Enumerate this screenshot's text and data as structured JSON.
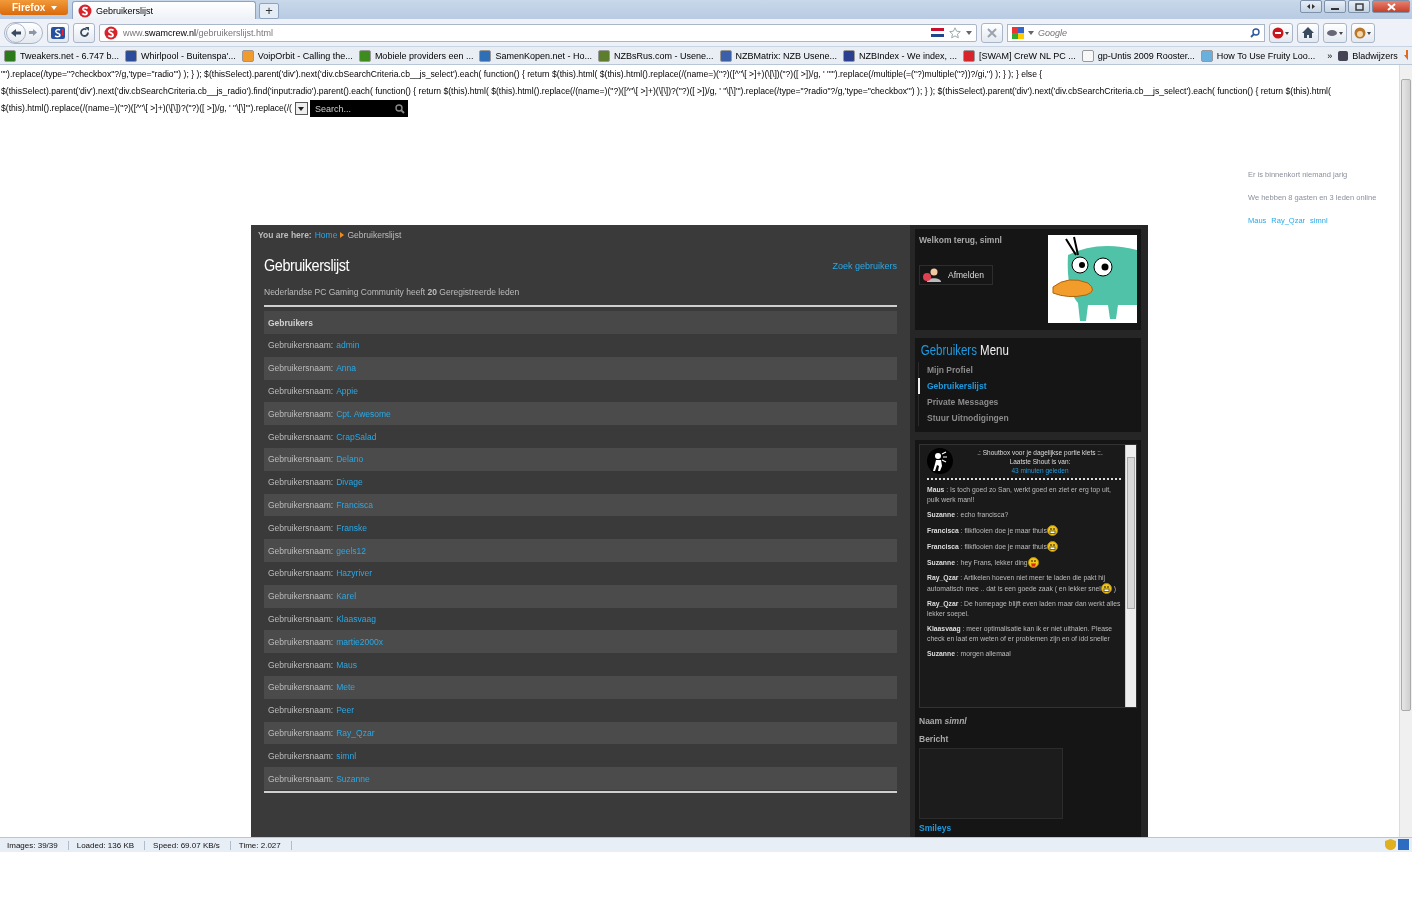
{
  "browser": {
    "app_button": "Firefox",
    "tabs": [
      {
        "title": "Gebruikerslijst",
        "selected": true
      }
    ],
    "new_tab": "+",
    "address": {
      "prefix": "www.",
      "domain": "swamcrew.nl",
      "path": "/gebruikerslijst.html"
    },
    "search": {
      "placeholder": "Google"
    },
    "bookmarks": [
      "Tweakers.net - 6.747 b...",
      "Whirlpool - Buitenspa'...",
      "VoipOrbit - Calling the...",
      "Mobiele providers een ...",
      "SamenKopen.net - Ho...",
      "NZBsRus.com - Usene...",
      "NZBMatrix: NZB Usene...",
      "NZBIndex - We index, ...",
      "[SWAM] CreW NL PC ...",
      "gp-Untis 2009 Rooster...",
      "How To Use Fruity Loo..."
    ],
    "bookmarks_overflow": "»",
    "bookmarks_menu": "Bladwijzers"
  },
  "page": {
    "code_lines": [
      "\"\").replace(/type=\"?checkbox\"?/g,'type=\"radio\"') ); } ); $(thisSelect).parent('div').next('div.cbSearchCriteria.cb__js_select').each( function() { return $(this).html( $(this).html().replace(/(name=)(\"?)([^\"\\[ >]+)(\\[\\])(\"?)([ >])/g, ' \"\"').replace(/multiple(=(\"?)multiple(\"?))?/gi,'') ); } ); } else {",
      "$(thisSelect).parent('div').next('div.cbSearchCriteria.cb__js_radio').find('input:radio').parent().each( function() { return $(this).html( $(this).html().replace(/(name=)(\"?)([^\"\\[ >]+)(\\[\\])?(\"?)([ >])/g, ' \"\\[\\]\"').replace(/type=\"?radio\"?/g,'type=\"checkbox\"') ); } ); $(thisSelect).parent('div').next('div.cbSearchCriteria.cb__js_select').each( function() { return $(this).html(",
      "$(this).html().replace(/(name=)(\"?)([^\"\\[ >]+)(\\[\\])?(\"?)([ >])/g, ' \"\\[\\]\"').replace(/("
    ],
    "search": {
      "placeholder": "Search..."
    },
    "breadcrumb": {
      "label": "You are here:",
      "items": [
        "Home",
        "Gebruikerslijst"
      ]
    },
    "title": "Gebruikerslijst",
    "search_users": "Zoek gebruikers",
    "summary": "Nederlandse PC Gaming Community heeft **20** Geregistreerde leden",
    "table": {
      "header": "Gebruikers",
      "rows": [
        {
          "label": "Gebruikersnaam:",
          "user": "admin"
        },
        {
          "label": "Gebruikersnaam:",
          "user": "Anna"
        },
        {
          "label": "Gebruikersnaam:",
          "user": "Appie"
        },
        {
          "label": "Gebruikersnaam:",
          "user": "Cpt. Awesome"
        },
        {
          "label": "Gebruikersnaam:",
          "user": "CrapSalad"
        },
        {
          "label": "Gebruikersnaam:",
          "user": "Delano"
        },
        {
          "label": "Gebruikersnaam:",
          "user": "Divage"
        },
        {
          "label": "Gebruikersnaam:",
          "user": "Francisca"
        },
        {
          "label": "Gebruikersnaam:",
          "user": "Franske"
        },
        {
          "label": "Gebruikersnaam:",
          "user": "geels12"
        },
        {
          "label": "Gebruikersnaam:",
          "user": "Hazyriver"
        },
        {
          "label": "Gebruikersnaam:",
          "user": "Karel"
        },
        {
          "label": "Gebruikersnaam:",
          "user": "Klaasvaag"
        },
        {
          "label": "Gebruikersnaam:",
          "user": "martie2000x"
        },
        {
          "label": "Gebruikersnaam:",
          "user": "Maus"
        },
        {
          "label": "Gebruikersnaam:",
          "user": "Mete"
        },
        {
          "label": "Gebruikersnaam:",
          "user": "Peer"
        },
        {
          "label": "Gebruikersnaam:",
          "user": "Ray_Qzar"
        },
        {
          "label": "Gebruikersnaam:",
          "user": "simnl"
        },
        {
          "label": "Gebruikersnaam:",
          "user": "Suzanne"
        }
      ]
    }
  },
  "sidebar": {
    "welcome": "Welkom terug, simnl",
    "logout": "Afmelden",
    "menu": {
      "title_accent": "Gebruikers",
      "title_rest": "Menu",
      "items": [
        {
          "label": "Mijn Profiel",
          "selected": false
        },
        {
          "label": "Gebruikerslijst",
          "selected": true
        },
        {
          "label": "Private Messages",
          "selected": false
        },
        {
          "label": "Stuur Uitnodigingen",
          "selected": false
        }
      ]
    },
    "shoutbox": {
      "intro": ".: Shoutbox voor je dagelijkse portie klets ::.",
      "last_label": "Laatste Shout is van:",
      "last_time": "43 minuten geleden",
      "shouts": [
        {
          "author": "Maus",
          "parts": [
            {
              "kind": "text",
              "text": " : Is toch goed zo San, werkt goed en ziet er erg top uit, puik werk man!!"
            }
          ]
        },
        {
          "author": "Suzanne",
          "parts": [
            {
              "kind": "text",
              "text": " : echo francisca?"
            }
          ]
        },
        {
          "author": "Francisca",
          "parts": [
            {
              "kind": "text",
              "text": " : flikflooien doe je maar thuis"
            },
            {
              "kind": "smiley"
            }
          ]
        },
        {
          "author": "Francisca",
          "parts": [
            {
              "kind": "text",
              "text": " : flikflooien doe je maar thuis"
            },
            {
              "kind": "smiley"
            }
          ]
        },
        {
          "author": "Suzanne",
          "parts": [
            {
              "kind": "text",
              "text": " : hey Frans, lekker ding"
            },
            {
              "kind": "tongue"
            }
          ]
        },
        {
          "author": "Ray_Qzar",
          "parts": [
            {
              "kind": "text",
              "text": " : Artikelen hoeven niet meer te laden die pakt hij automatisch mee .. dat is een goede zaak ( en lekker snel"
            },
            {
              "kind": "smiley"
            },
            {
              "kind": "text",
              "text": " )"
            }
          ]
        },
        {
          "author": "Ray_Qzar",
          "parts": [
            {
              "kind": "text",
              "text": " : De homepage blijft even laden maar dan werkt alles lekker soepel."
            }
          ]
        },
        {
          "author": "Klaasvaag",
          "parts": [
            {
              "kind": "text",
              "text": " : meer optimalisatie kan ik er niet uithalen. Please check en laat em weten of er problemen zijn en of idd sneller"
            }
          ]
        },
        {
          "author": "Suzanne",
          "parts": [
            {
              "kind": "text",
              "text": " : morgen allemaal"
            }
          ]
        }
      ]
    },
    "name_label": "Naam",
    "name_value": "simnl",
    "message_label": "Bericht",
    "smileys": "Smileys"
  },
  "side_info": {
    "birthdays": "Er is binnenkort niemand jarig",
    "online": "We hebben 8 gasten en 3 leden online",
    "members": [
      "Maus",
      "Ray_Qzar",
      "simnl"
    ]
  },
  "status_bar": [
    "Images: 39/39",
    "Loaded: 136 KB",
    "Speed: 69.07 KB/s",
    "Time: 2.027"
  ]
}
